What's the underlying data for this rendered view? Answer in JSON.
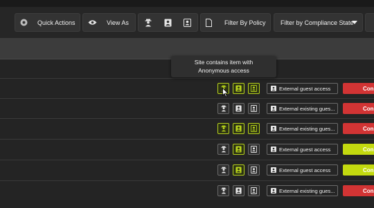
{
  "colors": {
    "accent_green": "#b8d31c",
    "status_red": "#d23434",
    "status_green": "#c3d90f",
    "toolbar_bg": "#262626"
  },
  "toolbar": {
    "quick_actions": {
      "label": "Quick Actions",
      "icon": "gear-circle-icon"
    },
    "view_as": {
      "label": "View As",
      "icon": "eye-icon"
    },
    "permission_icons": [
      "anonymous-user-icon",
      "external-user-icon",
      "external-existing-user-icon"
    ],
    "filter_policy": {
      "label": "Filter By Policy",
      "icon": "document-icon"
    },
    "filter_compliance": {
      "label": "Filter by Compliance State",
      "icon": "caret-down-icon"
    }
  },
  "tooltip": {
    "line1": "Site contains item with",
    "line2": "Anonymous access"
  },
  "rows": [
    {
      "active": [
        true,
        true,
        true
      ],
      "access_label": "External guest access",
      "status_color": "red",
      "status_text": "Con"
    },
    {
      "active": [
        false,
        false,
        false
      ],
      "access_label": "External existing gues...",
      "status_color": "red",
      "status_text": "Con"
    },
    {
      "active": [
        true,
        true,
        true
      ],
      "access_label": "External existing gues...",
      "status_color": "red",
      "status_text": "Con"
    },
    {
      "active": [
        false,
        true,
        false
      ],
      "access_label": "External guest access",
      "status_color": "green",
      "status_text": "Con"
    },
    {
      "active": [
        false,
        true,
        false
      ],
      "access_label": "External guest access",
      "status_color": "green",
      "status_text": "Con"
    },
    {
      "active": [
        false,
        false,
        false
      ],
      "access_label": "External existing gues...",
      "status_color": "red",
      "status_text": "Con"
    }
  ]
}
